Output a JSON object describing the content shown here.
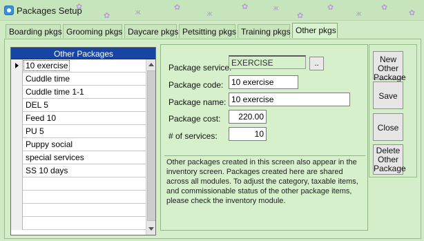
{
  "window": {
    "title": "Packages Setup"
  },
  "tabs": [
    {
      "label": "Boarding pkgs",
      "active": false
    },
    {
      "label": "Grooming pkgs",
      "active": false
    },
    {
      "label": "Daycare pkgs",
      "active": false
    },
    {
      "label": "Petsitting pkgs",
      "active": false
    },
    {
      "label": "Training pkgs",
      "active": false
    },
    {
      "label": "Other pkgs",
      "active": true
    }
  ],
  "grid": {
    "header": "Other Packages",
    "selected_index": 0,
    "rows": [
      "10 exercise",
      "Cuddle time",
      "Cuddle time 1-1",
      "DEL 5",
      "Feed 10",
      "PU 5",
      "Puppy social",
      "special services",
      "SS 10 days",
      "",
      "",
      "",
      ""
    ]
  },
  "form": {
    "service_label": "Package service:",
    "service_value": "EXERCISE",
    "browse_label": "..",
    "code_label": "Package code:",
    "code_value": "10 exercise",
    "name_label": "Package name:",
    "name_value": "10 exercise",
    "cost_label": "Package cost:",
    "cost_value": "220.00",
    "services_label": "# of services:",
    "services_value": "10",
    "info": "Other packages created in this screen also appear in the inventory screen. Packages created here are shared across all modules. To adjust the category, taxable items, and commissionable status of the other package items, please check the inventory module."
  },
  "buttons": {
    "new_other": "New Other Package",
    "save": "Save",
    "close": "Close",
    "delete_other": "Delete Other Package"
  },
  "colors": {
    "grid_header": "#1645a3",
    "window_bg": "#cfeac4",
    "panel_bg": "#d6f0cb"
  }
}
